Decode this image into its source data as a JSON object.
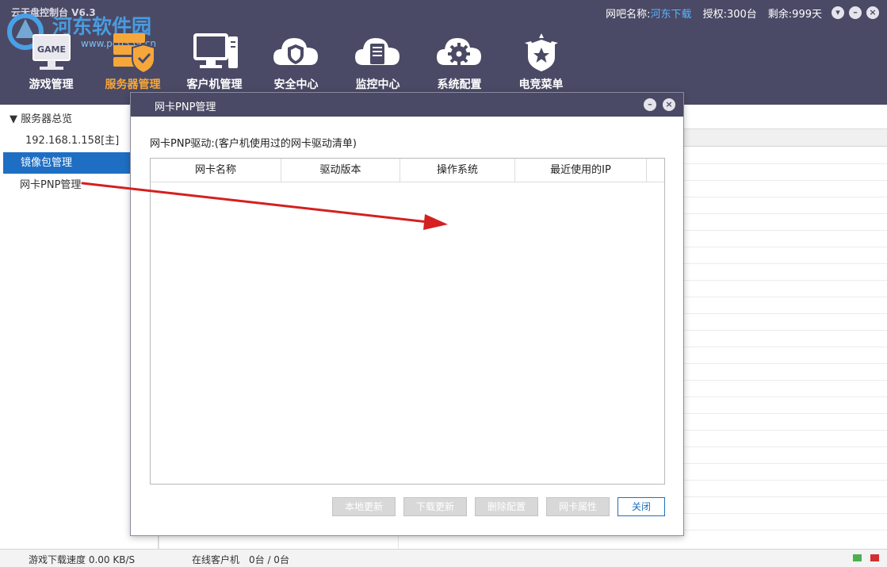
{
  "app": {
    "title": "云无盘控制台 V6.3",
    "bar_name_label": "网吧名称:",
    "bar_name_value": "河东下载",
    "license_label": "授权:",
    "license_value": "300台",
    "remaining_label": "剩余:",
    "remaining_value": "999天"
  },
  "watermark": {
    "title": "河东软件园",
    "url": "www.pc0359.cn"
  },
  "nav": {
    "items": [
      {
        "label": "游戏管理",
        "icon": "game-monitor-icon"
      },
      {
        "label": "服务器管理",
        "icon": "server-shield-icon",
        "active": true
      },
      {
        "label": "客户机管理",
        "icon": "client-computer-icon"
      },
      {
        "label": "安全中心",
        "icon": "cloud-shield-icon"
      },
      {
        "label": "监控中心",
        "icon": "cloud-server-icon"
      },
      {
        "label": "系统配置",
        "icon": "cloud-gear-icon"
      },
      {
        "label": "电竞菜单",
        "icon": "star-badge-icon"
      }
    ]
  },
  "sidebar": {
    "root": "▼ 服务器总览",
    "items": [
      {
        "label": "192.168.1.158[主]"
      },
      {
        "label": "镜像包管理",
        "selected": true
      },
      {
        "label": "网卡PNP管理"
      }
    ]
  },
  "dialog": {
    "title": "网卡PNP管理",
    "subtitle": "网卡PNP驱动:(客户机使用过的网卡驱动清单)",
    "columns": [
      "网卡名称",
      "驱动版本",
      "操作系统",
      "最近使用的IP"
    ],
    "rows": [],
    "buttons": {
      "local_update": "本地更新",
      "download_update": "下载更新",
      "delete_config": "删除配置",
      "nic_properties": "网卡属性",
      "close": "关闭"
    }
  },
  "statusbar": {
    "download_speed": "游戏下载速度 0.00 KB/S",
    "online_clients": "在线客户机　0台 / 0台"
  },
  "colors": {
    "header_bg": "#4a4a66",
    "active_nav": "#f6a73b",
    "selection_blue": "#1e6fc4",
    "link_blue": "#5ab4ff",
    "annotation_arrow": "#d42020",
    "status_led_green": "#4caf50",
    "status_led_red": "#d32f2f"
  }
}
